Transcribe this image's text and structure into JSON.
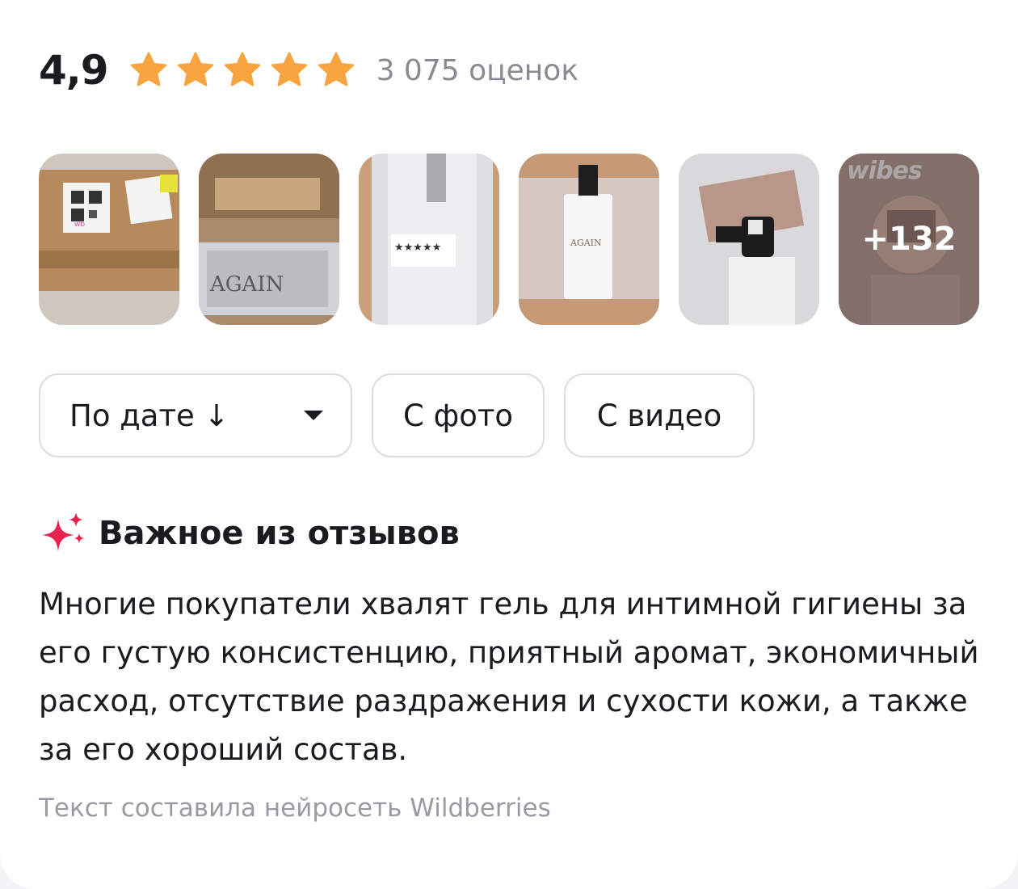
{
  "rating": {
    "value": "4,9",
    "stars_filled": 5,
    "stars_total": 5,
    "count_text": "3 075 оценок",
    "star_color": "#f9a43f"
  },
  "photos": {
    "more_label": "+132",
    "vibes_label": "wibes",
    "items": [
      {
        "name": "photo-box-qr"
      },
      {
        "name": "photo-box-open"
      },
      {
        "name": "photo-bubble-wrap"
      },
      {
        "name": "photo-bottle-packed"
      },
      {
        "name": "photo-pump"
      },
      {
        "name": "photo-more"
      }
    ]
  },
  "filters": {
    "sort_label": "По дате ↓",
    "photo_label": "С фото",
    "video_label": "С видео"
  },
  "summary": {
    "heading": "Важное из отзывов",
    "text": "Многие покупатели хвалят гель для интимной гигиены за его густую консистенцию, приятный аромат, экономичный расход, отсутствие раздражения и сухости кожи, а также за его хороший состав.",
    "note": "Текст составила нейросеть Wildberries",
    "sparkle_color": "#e8214d"
  }
}
